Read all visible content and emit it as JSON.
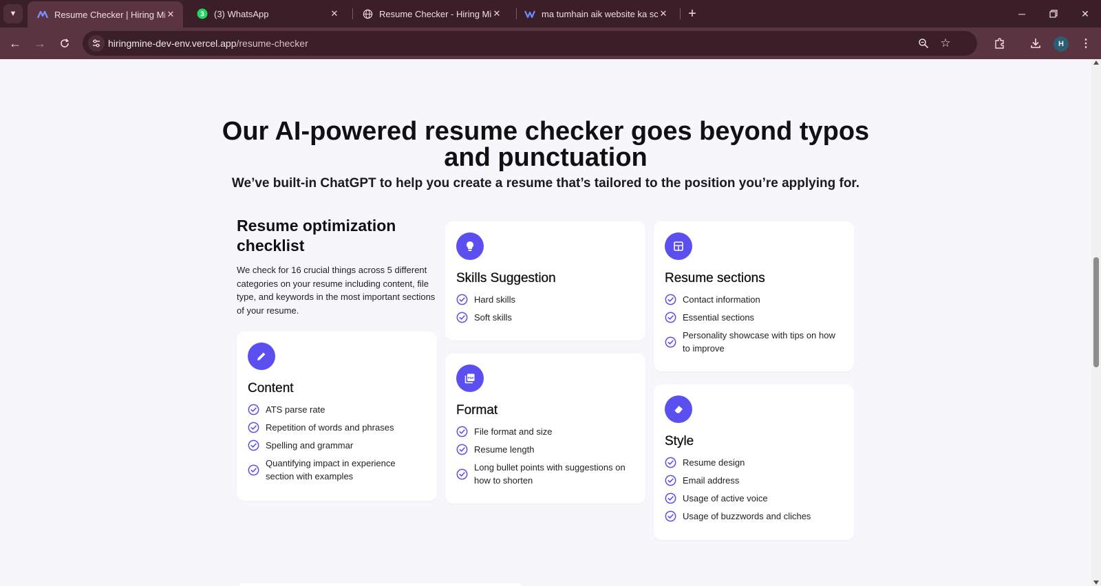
{
  "browser": {
    "tabs": [
      {
        "title": "Resume Checker | Hiring Mine",
        "icon": "hiringmine-logo-icon",
        "active": true
      },
      {
        "title": "(3) WhatsApp",
        "icon": "whatsapp-icon",
        "badge": "3",
        "active": false
      },
      {
        "title": "Resume Checker - Hiring Mine",
        "icon": "globe-icon",
        "active": false
      },
      {
        "title": "ma tumhain aik website ka scre",
        "icon": "app-logo-icon",
        "active": false
      }
    ],
    "url_host": "hiringmine-dev-env.vercel.app",
    "url_path": "/resume-checker",
    "profile_initial": "H"
  },
  "section": {
    "title": "Our AI-powered resume checker goes beyond typos and punctuation",
    "subtitle": "We’ve built-in ChatGPT to help you create a resume that’s tailored to the position you’re applying for."
  },
  "intro": {
    "title": "Resume optimization checklist",
    "text": "We check for 16 crucial things across 5 different categories on your resume including content, file type, and keywords in the most important sections of your resume."
  },
  "cards": {
    "skills": {
      "icon": "lightbulb-icon",
      "title": "Skills Suggestion",
      "items": [
        "Hard skills",
        "Soft skills"
      ]
    },
    "sections": {
      "icon": "layout-icon",
      "title": "Resume sections",
      "items": [
        "Contact information",
        "Essential sections",
        "Personality showcase with tips on how to improve"
      ]
    },
    "content": {
      "icon": "pencil-icon",
      "title": "Content",
      "items": [
        "ATS parse rate",
        "Repetition of words and phrases",
        "Spelling and grammar",
        "Quantifying impact in experience section with examples"
      ]
    },
    "format": {
      "icon": "pdf-icon",
      "title": "Format",
      "items": [
        "File format and size",
        "Resume length",
        "Long bullet points with suggestions on how to shorten"
      ]
    },
    "style": {
      "icon": "eraser-icon",
      "title": "Style",
      "items": [
        "Resume design",
        "Email address",
        "Usage of active voice",
        "Usage of buzzwords and cliches"
      ]
    }
  },
  "colors": {
    "accent": "#5b4ff0",
    "chrome_dark": "#3a1f28",
    "chrome_mid": "#5a3440",
    "page_bg": "#f6f6fb"
  }
}
